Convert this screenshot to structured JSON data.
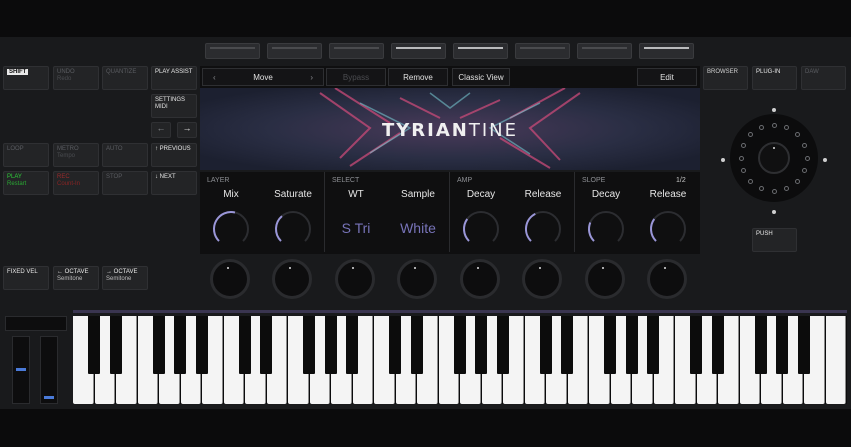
{
  "left_buttons": [
    {
      "name": "shift-button",
      "label": "SHIFT",
      "sub": "",
      "style": "white"
    },
    {
      "name": "undo-button",
      "label": "UNDO",
      "sub": "Redo",
      "style": ""
    },
    {
      "name": "quantize-button",
      "label": "QUANTIZE",
      "sub": "",
      "style": ""
    },
    {
      "name": "play-assist-button",
      "label": "PLAY ASSIST",
      "sub": "",
      "style": "white"
    },
    {
      "name": "settings-midi-button",
      "label": "SETTINGS",
      "sub": "MIDI",
      "style": "white"
    },
    {
      "name": "loop-button",
      "label": "LOOP",
      "sub": "",
      "style": ""
    },
    {
      "name": "metro-button",
      "label": "METRO",
      "sub": "Tempo",
      "style": ""
    },
    {
      "name": "auto-button",
      "label": "AUTO",
      "sub": "",
      "style": ""
    },
    {
      "name": "previous-button",
      "label": "↑ PREVIOUS",
      "sub": "",
      "style": "white"
    },
    {
      "name": "play-button",
      "label": "PLAY",
      "sub": "Restart",
      "style": "green"
    },
    {
      "name": "rec-button",
      "label": "REC",
      "sub": "Count-In",
      "style": "red"
    },
    {
      "name": "stop-button",
      "label": "STOP",
      "sub": "",
      "style": ""
    },
    {
      "name": "next-button",
      "label": "↓ NEXT",
      "sub": "",
      "style": "white"
    },
    {
      "name": "fixed-vel-button",
      "label": "FIXED VEL",
      "sub": "",
      "style": "white"
    },
    {
      "name": "octave-down-button",
      "label": "← OCTAVE",
      "sub": "Semitone",
      "style": "white"
    },
    {
      "name": "octave-up-button",
      "label": "→ OCTAVE",
      "sub": "Semitone",
      "style": "white"
    }
  ],
  "right_buttons": [
    {
      "name": "browser-button",
      "label": "BROWSER",
      "style": "white"
    },
    {
      "name": "plugin-button",
      "label": "PLUG-IN",
      "style": "white"
    },
    {
      "name": "daw-button",
      "label": "DAW",
      "style": ""
    },
    {
      "name": "push-button",
      "label": "PUSH",
      "style": "white"
    }
  ],
  "arrows": {
    "left": "←",
    "right": "→"
  },
  "nav": {
    "prev": "‹",
    "title": "Move",
    "next": "›",
    "bypass": "Bypass",
    "remove": "Remove",
    "classic_view": "Classic View",
    "edit": "Edit"
  },
  "banner": {
    "logo_part1": "TYRIAN",
    "logo_part2": "TINE"
  },
  "page_indicator": "1/2",
  "groups": [
    {
      "label": "LAYER",
      "params": [
        {
          "name": "Mix",
          "value": "",
          "knob": 0.55
        },
        {
          "name": "Saturate",
          "value": "",
          "knob": 0.35
        }
      ]
    },
    {
      "label": "SELECT",
      "params": [
        {
          "name": "WT",
          "value": "S Tri",
          "knob": null
        },
        {
          "name": "Sample",
          "value": "White",
          "knob": null
        }
      ]
    },
    {
      "label": "AMP",
      "params": [
        {
          "name": "Decay",
          "value": "",
          "knob": 0.3
        },
        {
          "name": "Release",
          "value": "",
          "knob": 0.4
        }
      ]
    },
    {
      "label": "SLOPE",
      "params": [
        {
          "name": "Decay",
          "value": "",
          "knob": 0.25
        },
        {
          "name": "Release",
          "value": "",
          "knob": 0.3
        }
      ]
    }
  ],
  "colors": {
    "accent": "#7773b8",
    "knob_arc": "#9a96d8",
    "play_green": "#2fcf3a",
    "rec_red": "#9a2a2a",
    "slider_blue": "#4a7ad8"
  },
  "sliders": {
    "pitch": 0.5,
    "mod": 0.05
  }
}
